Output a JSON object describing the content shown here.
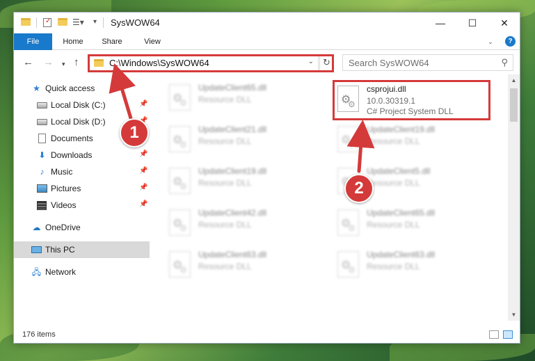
{
  "window": {
    "title": "SysWOW64"
  },
  "ribbon": {
    "tabs": [
      "File",
      "Home",
      "Share",
      "View"
    ],
    "help_label": "?"
  },
  "titlebar": {
    "minimize": "—",
    "maximize": "☐",
    "close": "✕"
  },
  "navbar": {
    "address_path": "C:\\Windows\\SysWOW64",
    "search_placeholder": "Search SysWOW64"
  },
  "sidebar": {
    "items": [
      {
        "label": "Quick access",
        "icon": "star-icon",
        "pinned": false
      },
      {
        "label": "Local Disk (C:)",
        "icon": "drive-icon",
        "pinned": true
      },
      {
        "label": "Local Disk (D:)",
        "icon": "drive-icon",
        "pinned": true
      },
      {
        "label": "Documents",
        "icon": "documents-icon",
        "pinned": true
      },
      {
        "label": "Downloads",
        "icon": "downloads-icon",
        "pinned": true
      },
      {
        "label": "Music",
        "icon": "music-icon",
        "pinned": true
      },
      {
        "label": "Pictures",
        "icon": "pictures-icon",
        "pinned": true
      },
      {
        "label": "Videos",
        "icon": "videos-icon",
        "pinned": true
      },
      {
        "label": "OneDrive",
        "icon": "onedrive-icon",
        "pinned": false
      },
      {
        "label": "This PC",
        "icon": "this-pc-icon",
        "pinned": false,
        "selected": true
      },
      {
        "label": "Network",
        "icon": "network-icon",
        "pinned": false
      }
    ]
  },
  "files": {
    "featured": {
      "name": "csprojui.dll",
      "version": "10.0.30319.1",
      "description": "C# Project System DLL"
    },
    "items": [
      {
        "name": "UpdateClient65.dll",
        "type": "Resource DLL"
      },
      {
        "name": "UpdateClient21.dll",
        "type": "Resource DLL"
      },
      {
        "name": "UpdateClient19.dll",
        "type": "Resource DLL"
      },
      {
        "name": "UpdateClient19.dll",
        "type": "Resource DLL"
      },
      {
        "name": "UpdateClient5.dll",
        "type": "Resource DLL"
      },
      {
        "name": "UpdateClient42.dll",
        "type": "Resource DLL"
      },
      {
        "name": "UpdateClient65.dll",
        "type": "Resource DLL"
      },
      {
        "name": "UpdateClient63.dll",
        "type": "Resource DLL"
      },
      {
        "name": "UpdateClient63.dll",
        "type": "Resource DLL"
      }
    ]
  },
  "status": {
    "item_count": "176 items"
  },
  "callouts": {
    "step1": "1",
    "step2": "2"
  },
  "colors": {
    "accent": "#1979ca",
    "highlight": "#d43a3a",
    "selected_row": "#d9d9d9"
  }
}
